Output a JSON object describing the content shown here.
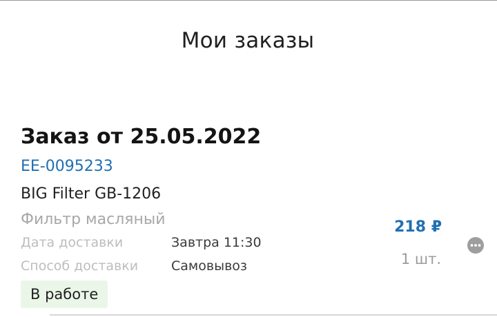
{
  "header": {
    "title": "Мои заказы"
  },
  "order": {
    "title": "Заказ от 25.05.2022",
    "number": "EE-0095233",
    "product_name": "BIG Filter GB-1206",
    "product_subtitle": "Фильтр масляный",
    "delivery_date_label": "Дата доставки",
    "delivery_date_value": "Завтра 11:30",
    "delivery_method_label": "Способ доставки",
    "delivery_method_value": "Самовывоз",
    "status": "В работе",
    "price": "218 ₽",
    "quantity": "1 шт.",
    "more_icon": "more-horizontal-icon"
  },
  "colors": {
    "accent": "#1f6fb3",
    "status_bg": "#eaf7e8",
    "muted_text": "#bdbdbd",
    "icon_bg": "#9e9e9e"
  }
}
